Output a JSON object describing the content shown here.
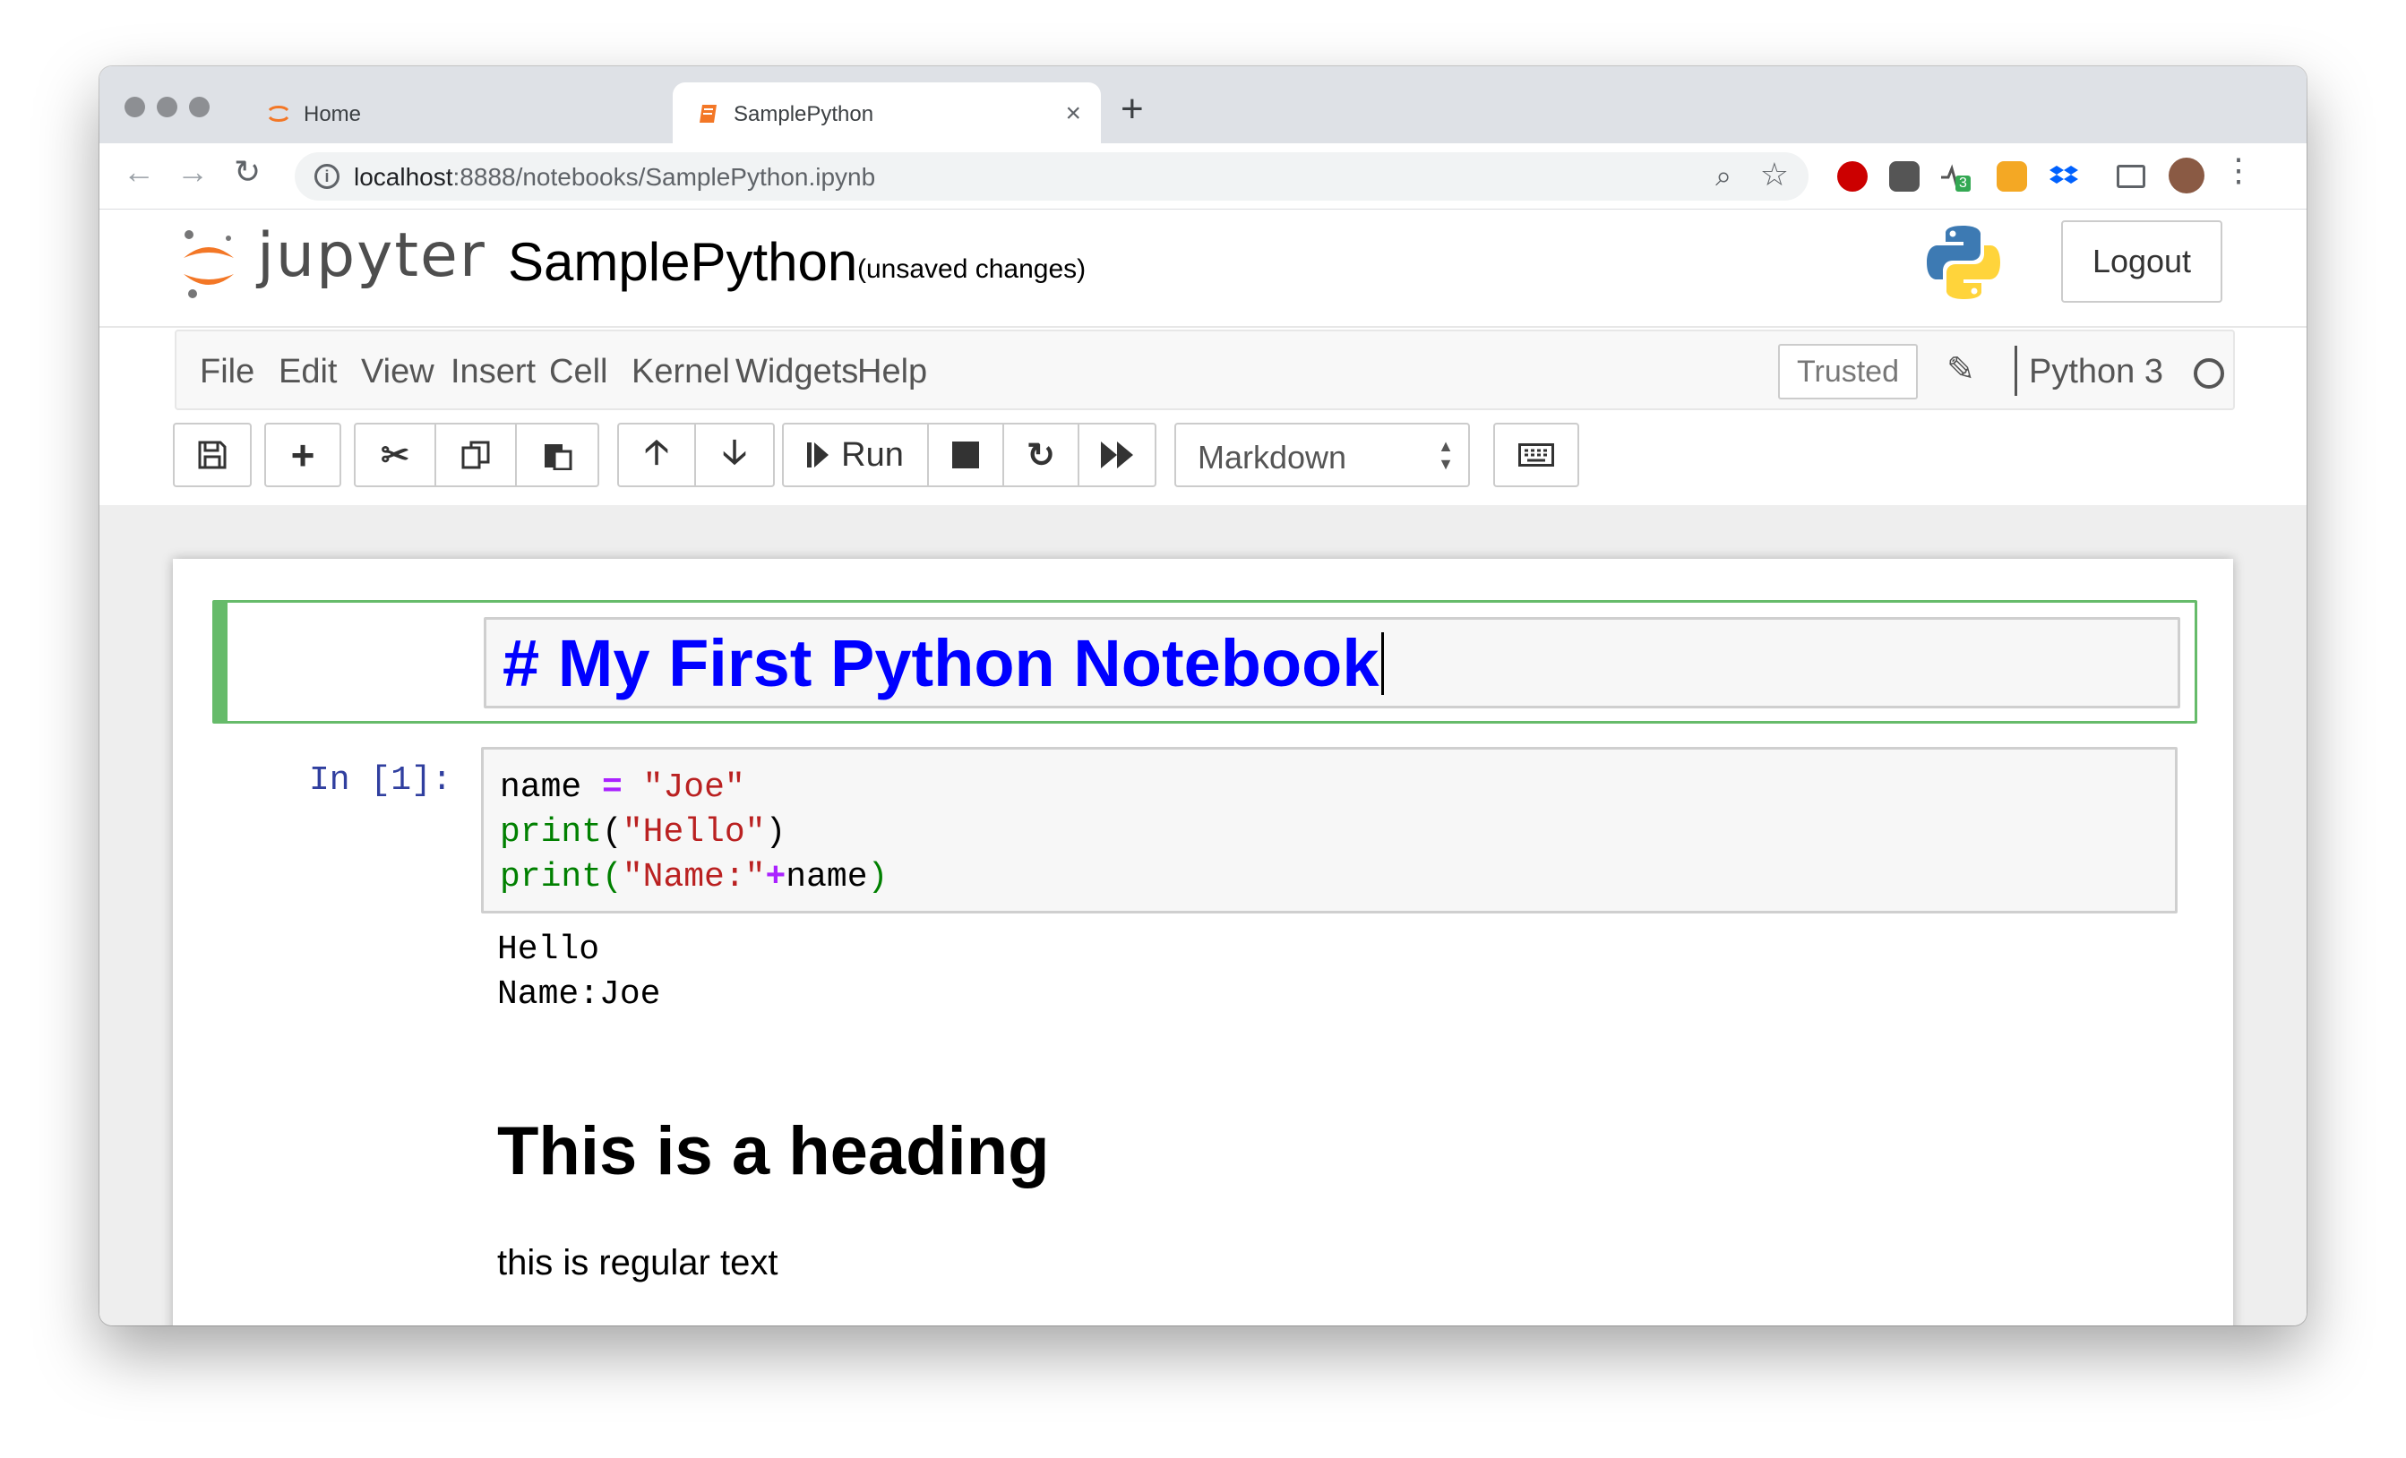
{
  "browser": {
    "tabs": [
      {
        "title": "Home",
        "favicon": "jupyter-icon",
        "active": false
      },
      {
        "title": "SamplePython",
        "favicon": "notebook-icon",
        "active": true
      }
    ],
    "new_tab_symbol": "+",
    "close_symbol": "×",
    "url_host": "localhost",
    "url_path": ":8888/notebooks/SamplePython.ipynb",
    "extension_badge": "3"
  },
  "header": {
    "logo_text": "jupyter",
    "notebook_name": "SamplePython",
    "save_status": "(unsaved changes)",
    "logout_label": "Logout"
  },
  "menubar": {
    "items": [
      "File",
      "Edit",
      "View",
      "Insert",
      "Cell",
      "Kernel",
      "Widgets",
      "Help"
    ],
    "trusted_label": "Trusted",
    "kernel_name": "Python 3"
  },
  "toolbar": {
    "run_label": "Run",
    "cell_type": "Markdown"
  },
  "notebook": {
    "markdown_source": "# My First Python Notebook",
    "code_prompt": "In [1]:",
    "code_lines": [
      [
        {
          "t": "name ",
          "c": ""
        },
        {
          "t": "=",
          "c": "op"
        },
        {
          "t": " ",
          "c": ""
        },
        {
          "t": "\"Joe\"",
          "c": "str"
        }
      ],
      [
        {
          "t": "print",
          "c": "kw-green"
        },
        {
          "t": "(",
          "c": ""
        },
        {
          "t": "\"Hello\"",
          "c": "str"
        },
        {
          "t": ")",
          "c": ""
        }
      ],
      [
        {
          "t": "print",
          "c": "kw-green"
        },
        {
          "t": "(",
          "c": "kw-green"
        },
        {
          "t": "\"Name:\"",
          "c": "str"
        },
        {
          "t": "+",
          "c": "op"
        },
        {
          "t": "name",
          "c": ""
        },
        {
          "t": ")",
          "c": "kw-green"
        }
      ]
    ],
    "output_lines": [
      "Hello",
      "Name:Joe"
    ],
    "rendered_heading": "This is a heading",
    "rendered_text": "this is regular text"
  },
  "colors": {
    "selected_cell_border": "#66bb6a",
    "markdown_heading": "#0000ff",
    "prompt": "#303f9f",
    "jupyter_orange": "#f37726"
  }
}
